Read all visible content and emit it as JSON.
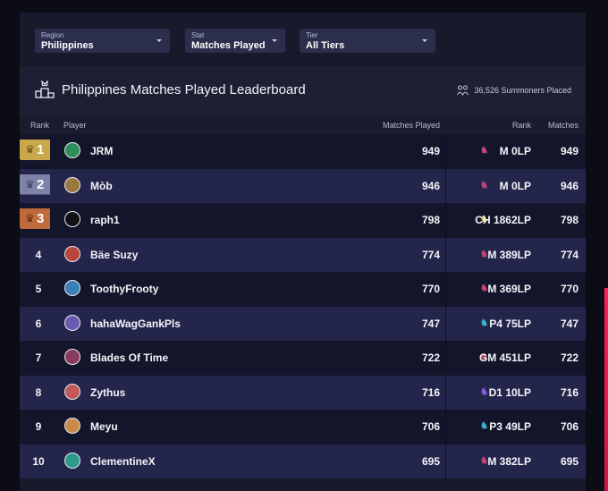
{
  "colors": {
    "accent": "#ff1f5a",
    "panel": "#181a2b",
    "gold": "#c9a84c",
    "silver": "#7e82a6",
    "bronze": "#c06a3c"
  },
  "filters": [
    {
      "label": "Region",
      "value": "Philippines"
    },
    {
      "label": "Stat",
      "value": "Matches Played"
    },
    {
      "label": "Tier",
      "value": "All Tiers"
    }
  ],
  "header": {
    "title": "Philippines Matches Played Leaderboard",
    "summoners_placed": "36,526 Summoners Placed"
  },
  "columns": {
    "rank": "Rank",
    "player": "Player",
    "matches_played": "Matches Played",
    "tier_rank": "Rank",
    "matches": "Matches"
  },
  "rows": [
    {
      "rank": "1",
      "player": "JRM",
      "matches_played": "949",
      "tier": "M 0LP",
      "matches": "949",
      "tier_icon": "master-icon",
      "tier_color": "#c0457a",
      "avatar_color": "#2f8f5a"
    },
    {
      "rank": "2",
      "player": "Mòb",
      "matches_played": "946",
      "tier": "M 0LP",
      "matches": "946",
      "tier_icon": "master-icon",
      "tier_color": "#c0457a",
      "avatar_color": "#9a7a3c"
    },
    {
      "rank": "3",
      "player": "raph1",
      "matches_played": "798",
      "tier": "CH 1862LP",
      "matches": "798",
      "tier_icon": "challenger-icon",
      "tier_color": "#e0c14a",
      "avatar_color": "#111111"
    },
    {
      "rank": "4",
      "player": "Bäe Suzy",
      "matches_played": "774",
      "tier": "M 389LP",
      "matches": "774",
      "tier_icon": "master-icon",
      "tier_color": "#c0457a",
      "avatar_color": "#b8443a"
    },
    {
      "rank": "5",
      "player": "ToothyFrooty",
      "matches_played": "770",
      "tier": "M 369LP",
      "matches": "770",
      "tier_icon": "master-icon",
      "tier_color": "#c0457a",
      "avatar_color": "#3a7fb8"
    },
    {
      "rank": "6",
      "player": "hahaWagGankPls",
      "matches_played": "747",
      "tier": "P4 75LP",
      "matches": "747",
      "tier_icon": "platinum-icon",
      "tier_color": "#39b3c9",
      "avatar_color": "#6a5ab0"
    },
    {
      "rank": "7",
      "player": "Blades Of Time",
      "matches_played": "722",
      "tier": "GM 451LP",
      "matches": "722",
      "tier_icon": "grandmaster-icon",
      "tier_color": "#b84a6a",
      "avatar_color": "#8a3a5a"
    },
    {
      "rank": "8",
      "player": "Zythus",
      "matches_played": "716",
      "tier": "D1 10LP",
      "matches": "716",
      "tier_icon": "diamond-icon",
      "tier_color": "#8a5ae0",
      "avatar_color": "#c05a5a"
    },
    {
      "rank": "9",
      "player": "Meyu",
      "matches_played": "706",
      "tier": "P3 49LP",
      "matches": "706",
      "tier_icon": "platinum-icon",
      "tier_color": "#39b3c9",
      "avatar_color": "#c98a4a"
    },
    {
      "rank": "10",
      "player": "ClementineX",
      "matches_played": "695",
      "tier": "M 382LP",
      "matches": "695",
      "tier_icon": "master-icon",
      "tier_color": "#c0457a",
      "avatar_color": "#2f9a8a"
    }
  ]
}
